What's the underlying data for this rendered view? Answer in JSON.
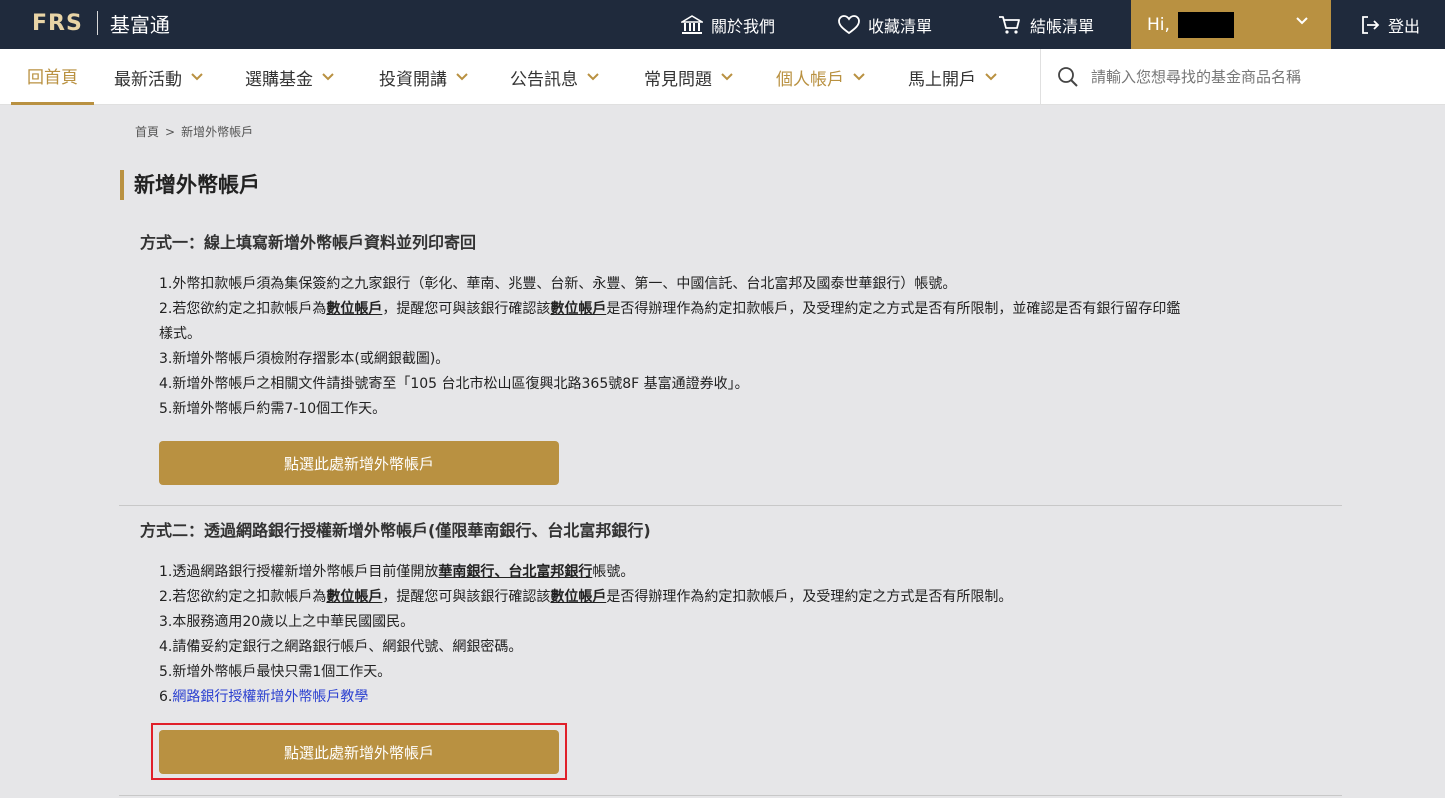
{
  "header": {
    "logo_mark": "FRS",
    "logo_name": "基富通",
    "about_label": "關於我們",
    "favorites_label": "收藏清單",
    "cart_label": "結帳清單",
    "greeting": "Hi,",
    "logout_label": "登出"
  },
  "nav": {
    "items": [
      "回首頁",
      "最新活動",
      "選購基金",
      "投資開講",
      "公告訊息",
      "常見問題",
      "個人帳戶",
      "馬上開戶"
    ],
    "search_placeholder": "請輸入您想尋找的基金商品名稱"
  },
  "breadcrumb": {
    "home": "首頁",
    "separator": ">",
    "current": "新增外幣帳戶"
  },
  "page_title": "新增外幣帳戶",
  "method1": {
    "title": "方式一：線上填寫新增外幣帳戶資料並列印寄回",
    "item1": "1.外幣扣款帳戶須為集保簽約之九家銀行（彰化、華南、兆豐、台新、永豐、第一、中國信託、台北富邦及國泰世華銀行）帳號。",
    "item2_a": "2.若您欲約定之扣款帳戶為",
    "item2_b": "數位帳戶",
    "item2_c": "，提醒您可與該銀行確認該",
    "item2_d": "數位帳戶",
    "item2_e": "是否得辦理作為約定扣款帳戶，及受理約定之方式是否有所限制，並確認是否有銀行留存印鑑",
    "item2_f": "樣式。",
    "item3": "3.新增外幣帳戶須檢附存摺影本(或網銀截圖)。",
    "item4": "4.新增外幣帳戶之相關文件請掛號寄至「105 台北市松山區復興北路365號8F 基富通證券收」。",
    "item5": "5.新增外幣帳戶約需7-10個工作天。",
    "button_label": "點選此處新增外幣帳戶"
  },
  "method2": {
    "title": "方式二：透過網路銀行授權新增外幣帳戶(僅限華南銀行、台北富邦銀行)",
    "item1_a": "1.透過網路銀行授權新增外幣帳戶目前僅開放",
    "item1_b": "華南銀行、台北富邦銀行",
    "item1_c": "帳號。",
    "item2_a": "2.若您欲約定之扣款帳戶為",
    "item2_b": "數位帳戶",
    "item2_c": "，提醒您可與該銀行確認該",
    "item2_d": "數位帳戶",
    "item2_e": "是否得辦理作為約定扣款帳戶，及受理約定之方式是否有所限制。",
    "item3": "3.本服務適用20歲以上之中華民國國民。",
    "item4": "4.請備妥約定銀行之網路銀行帳戶、網銀代號、網銀密碼。",
    "item5": "5.新增外幣帳戶最快只需1個工作天。",
    "item6_num": "6.",
    "item6_link": "網路銀行授權新增外幣帳戶教學",
    "button_label": "點選此處新增外幣帳戶"
  },
  "colors": {
    "topbar": "#1f2a3c",
    "accent_gold": "#b99141",
    "background": "#e6e6e8",
    "link_blue": "#2a3fd0",
    "highlight_red": "#e0202a"
  }
}
